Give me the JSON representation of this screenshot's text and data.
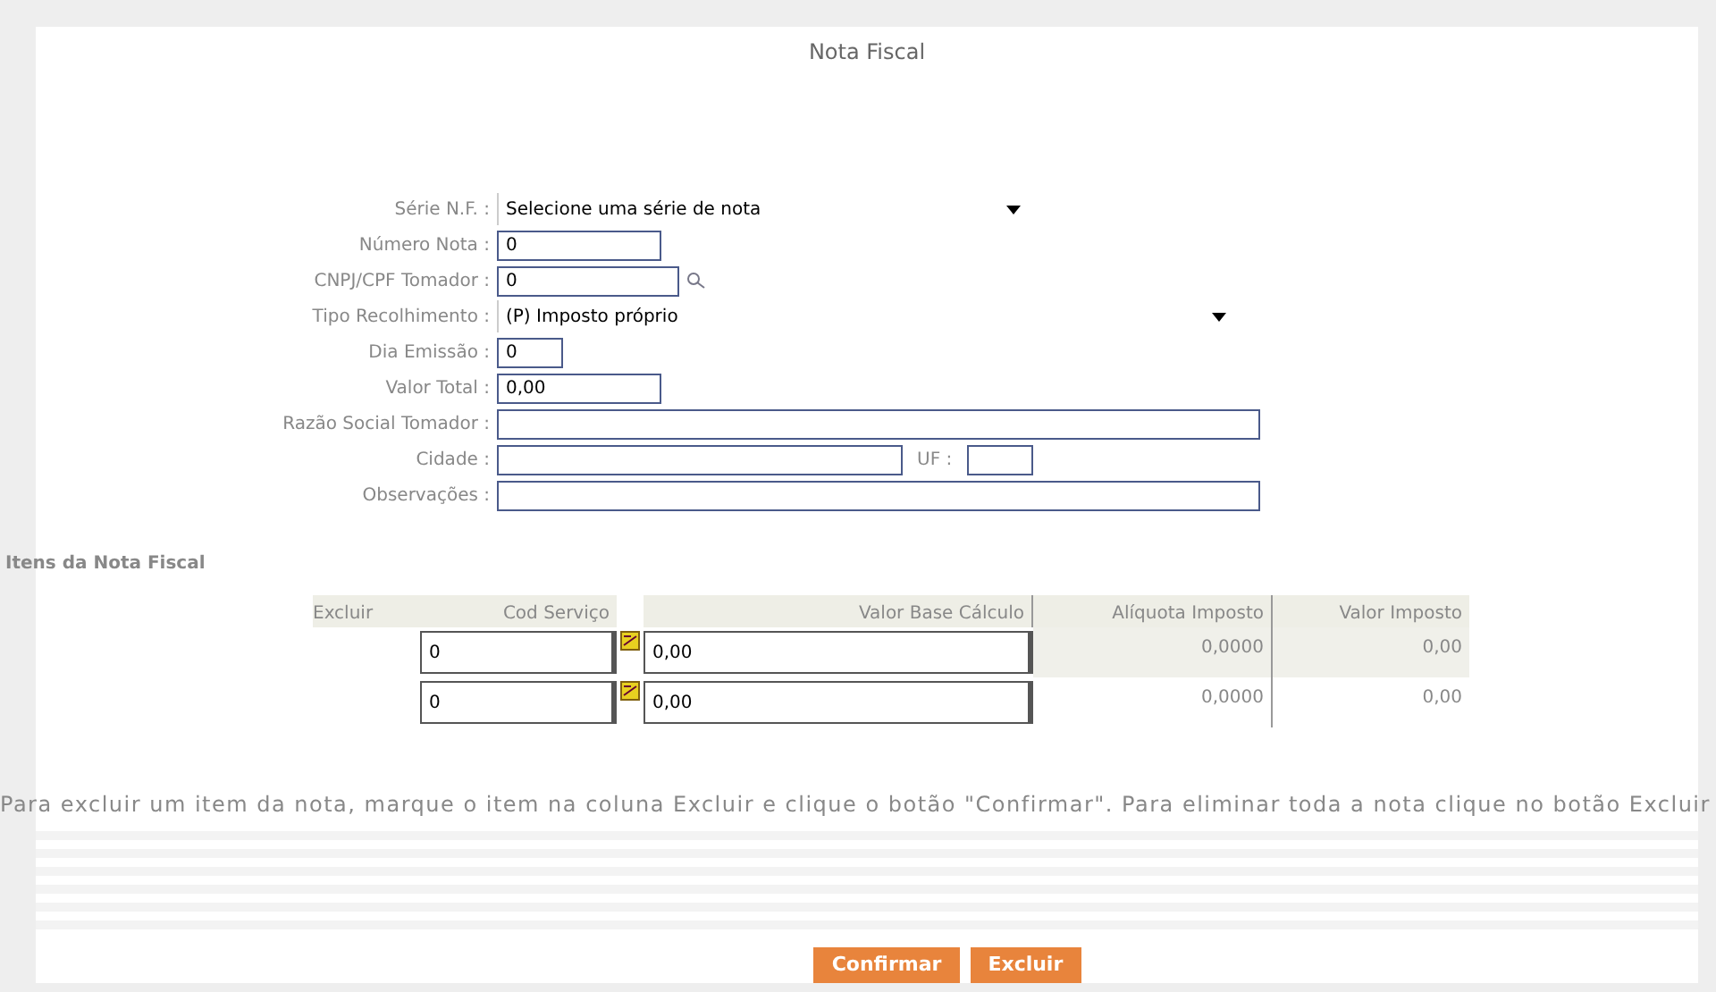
{
  "title": "Nota Fiscal",
  "fields": [
    {
      "kind": "select",
      "label": "Série N.F. :",
      "value": "Selecione uma série de nota"
    },
    {
      "kind": "input",
      "label": "Número Nota :",
      "value": "0"
    },
    {
      "kind": "search",
      "label": "CNPJ/CPF Tomador :",
      "value": "0"
    },
    {
      "kind": "select",
      "label": "Tipo Recolhimento :",
      "value": "(P) Imposto próprio"
    },
    {
      "kind": "input",
      "label": "Dia Emissão :",
      "value": "0"
    },
    {
      "kind": "input",
      "label": "Valor Total :",
      "value": "0,00"
    },
    {
      "kind": "input",
      "label": "Razão Social Tomador :"
    },
    {
      "kind": "city",
      "label": "Cidade :",
      "extra_label": "UF :"
    },
    {
      "kind": "input",
      "label": "Observações :"
    }
  ],
  "items": {
    "title": "Itens da Nota Fiscal",
    "columns": [
      "Excluir",
      "Cod Serviço",
      "Valor Base Cálculo",
      "Alíquota Imposto",
      "Valor Imposto"
    ],
    "rows": [
      {
        "cod": "0",
        "base": "0,00",
        "aliquota": "0,0000",
        "imposto": "0,00"
      },
      {
        "cod": "0",
        "base": "0,00",
        "aliquota": "0,0000",
        "imposto": "0,00"
      }
    ]
  },
  "note": "Para excluir um item da nota, marque o item na coluna Excluir e clique o botão \"Confirmar\". Para eliminar toda a nota clique no botão Excluir",
  "buttons": [
    "Confirmar",
    "Excluir"
  ]
}
